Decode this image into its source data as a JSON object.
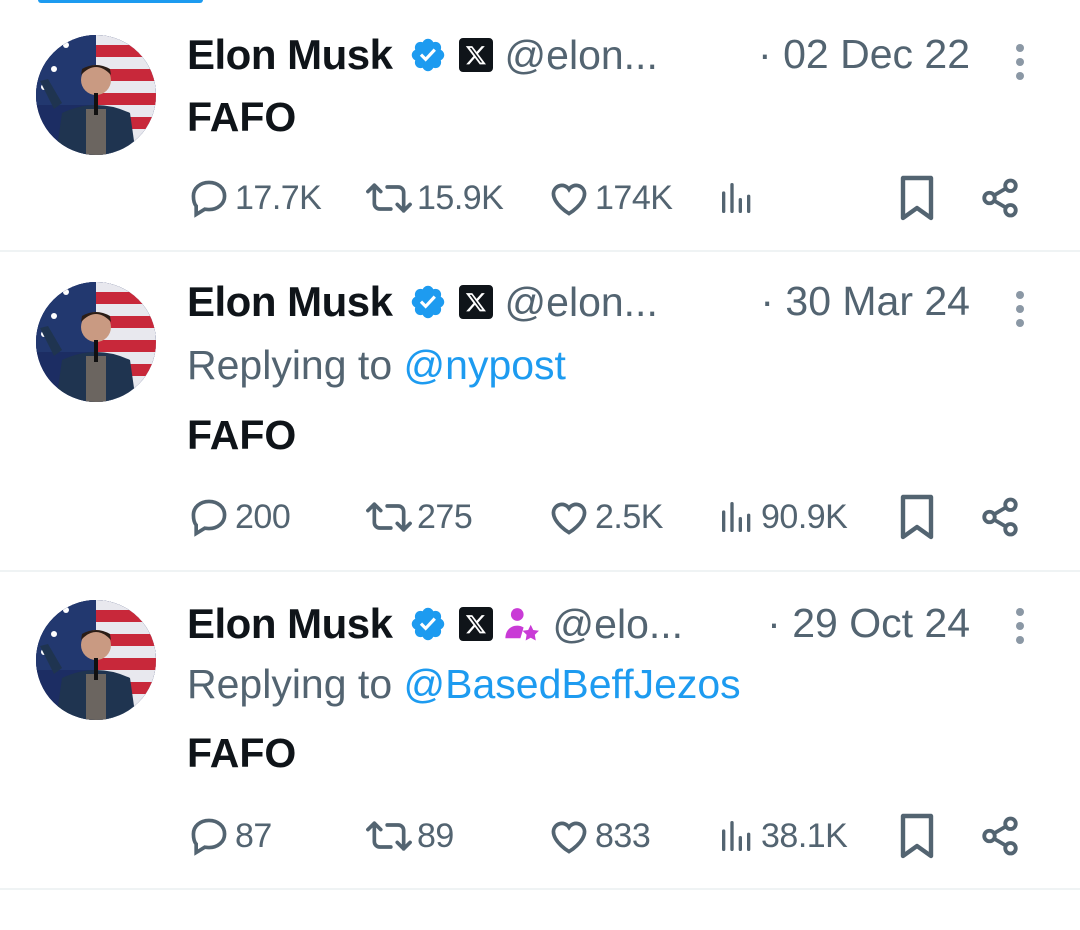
{
  "tweets": [
    {
      "author_name": "Elon Musk",
      "handle": "@elon...",
      "date": "· 02 Dec 22",
      "replying_to_label": "",
      "replying_to_handle": "",
      "text": "FAFO",
      "replies": "17.7K",
      "reposts": "15.9K",
      "likes": "174K",
      "views": "",
      "has_affiliate_badge": false
    },
    {
      "author_name": "Elon Musk",
      "handle": "@elon...",
      "date": "· 30 Mar 24",
      "replying_to_label": "Replying to ",
      "replying_to_handle": "@nypost",
      "text": "FAFO",
      "replies": "200",
      "reposts": "275",
      "likes": "2.5K",
      "views": "90.9K",
      "has_affiliate_badge": false
    },
    {
      "author_name": "Elon Musk",
      "handle": "@elo...",
      "date": "· 29 Oct 24",
      "replying_to_label": "Replying to ",
      "replying_to_handle": "@BasedBeffJezos",
      "text": "FAFO",
      "replies": "87",
      "reposts": "89",
      "likes": "833",
      "views": "38.1K",
      "has_affiliate_badge": true
    }
  ],
  "colors": {
    "accent": "#1d9bf0",
    "secondary_text": "#536471",
    "primary_text": "#0f1419",
    "affiliate_badge": "#c93bd6"
  },
  "icons": [
    "verified-badge-icon",
    "x-logo-badge-icon",
    "affiliate-person-star-icon",
    "more-vertical-icon",
    "reply-icon",
    "repost-icon",
    "like-icon",
    "views-icon",
    "bookmark-icon",
    "share-icon"
  ]
}
